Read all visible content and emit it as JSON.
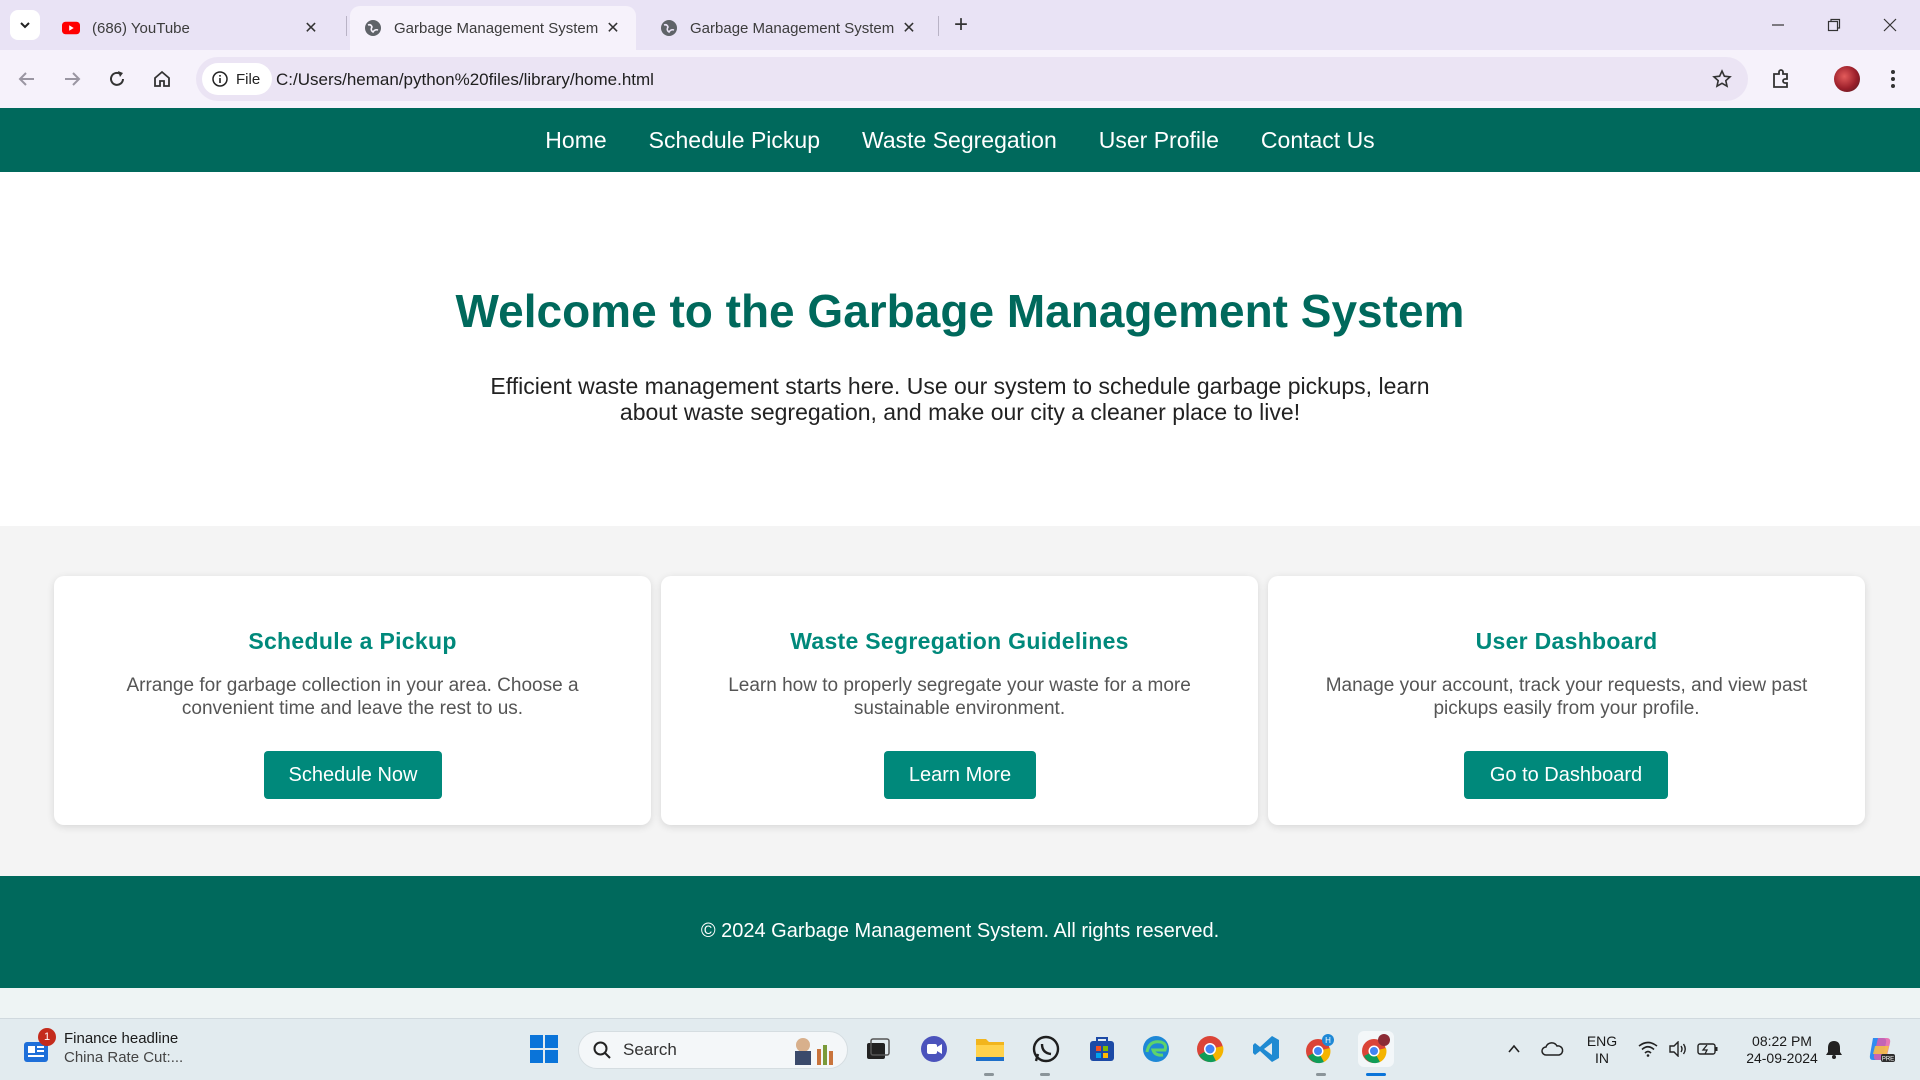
{
  "browser": {
    "tabs": [
      {
        "title": "(686) YouTube",
        "favicon": "youtube-icon",
        "active": false
      },
      {
        "title": "Garbage Management System -",
        "favicon": "globe-icon",
        "active": true
      },
      {
        "title": "Garbage Management System -",
        "favicon": "globe-icon",
        "active": false
      }
    ],
    "chip_label": "File",
    "url": "C:/Users/heman/python%20files/library/home.html"
  },
  "site": {
    "nav": [
      "Home",
      "Schedule Pickup",
      "Waste Segregation",
      "User Profile",
      "Contact Us"
    ],
    "hero": {
      "title": "Welcome to the Garbage Management System",
      "subtitle": "Efficient waste management starts here. Use our system to schedule garbage pickups, learn about waste segregation, and make our city a cleaner place to live!"
    },
    "cards": [
      {
        "title": "Schedule a Pickup",
        "text": "Arrange for garbage collection in your area. Choose a convenient time and leave the rest to us.",
        "button": "Schedule Now"
      },
      {
        "title": "Waste Segregation Guidelines",
        "text": "Learn how to properly segregate your waste for a more sustainable environment.",
        "button": "Learn More"
      },
      {
        "title": "User Dashboard",
        "text": "Manage your account, track your requests, and view past pickups easily from your profile.",
        "button": "Go to Dashboard"
      }
    ],
    "footer": "© 2024 Garbage Management System. All rights reserved.",
    "colors": {
      "primary": "#00695c",
      "accent": "#00897b"
    }
  },
  "taskbar": {
    "news": {
      "badge": "1",
      "headline": "Finance headline",
      "snippet": "China Rate Cut:..."
    },
    "search_placeholder": "Search",
    "language": {
      "line1": "ENG",
      "line2": "IN"
    },
    "time": "08:22 PM",
    "date": "24-09-2024"
  }
}
